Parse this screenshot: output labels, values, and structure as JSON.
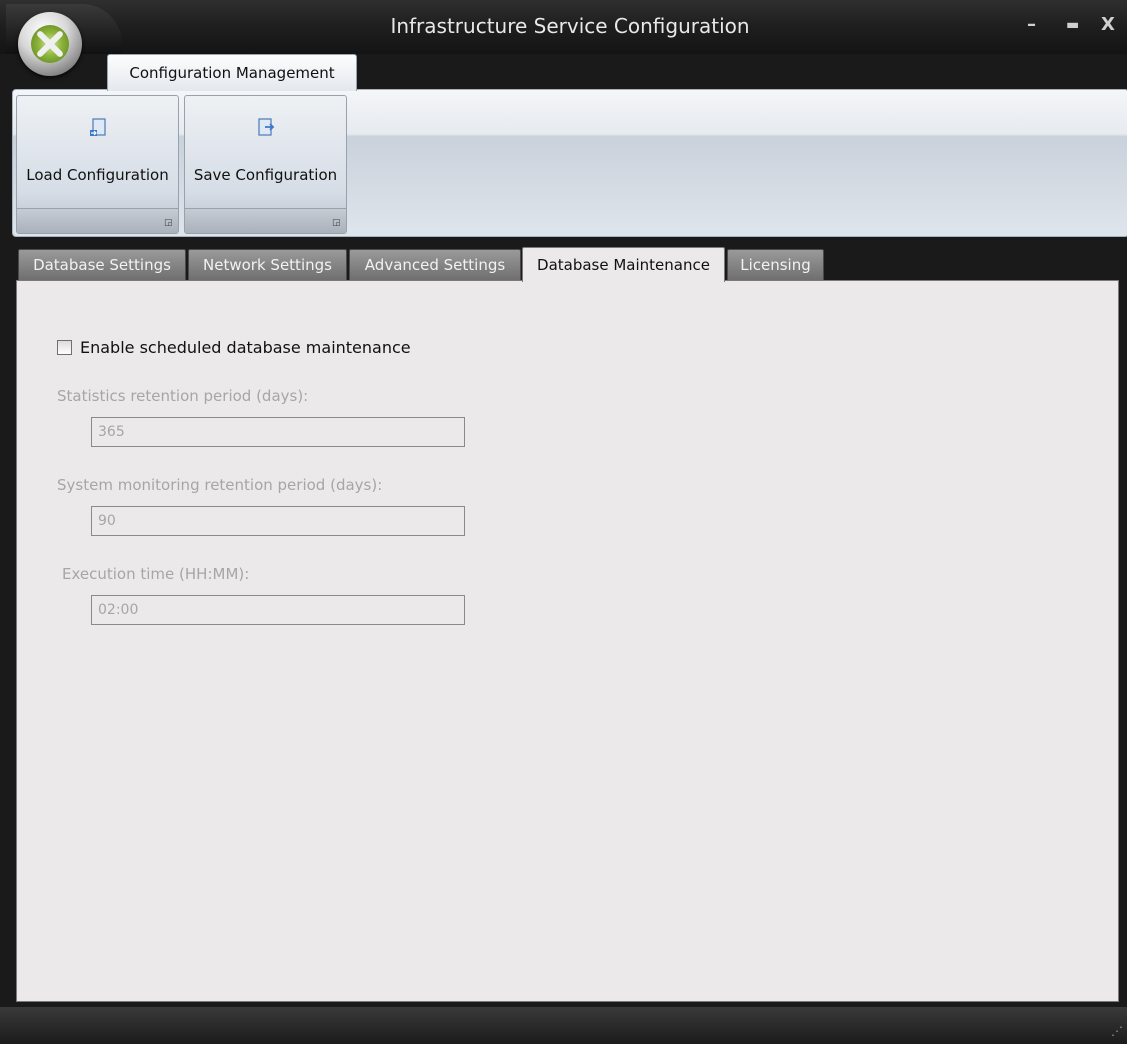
{
  "window": {
    "title": "Infrastructure Service Configuration",
    "minimize": "–",
    "maximize": "▬",
    "close": "X"
  },
  "ribbon": {
    "tab_label": "Configuration Management",
    "buttons": [
      {
        "label": "Load Configuration",
        "icon": "load-config-icon"
      },
      {
        "label": "Save Configuration",
        "icon": "save-config-icon"
      }
    ]
  },
  "tabs": [
    {
      "label": "Database Settings",
      "active": false
    },
    {
      "label": "Network Settings",
      "active": false
    },
    {
      "label": "Advanced Settings",
      "active": false
    },
    {
      "label": "Database Maintenance",
      "active": true
    },
    {
      "label": "Licensing",
      "active": false
    }
  ],
  "maintenance": {
    "enable_label": "Enable scheduled database maintenance",
    "enabled": false,
    "statistics_label": "Statistics retention period (days):",
    "statistics_value": "365",
    "monitoring_label": "System monitoring retention period (days):",
    "monitoring_value": "90",
    "execution_label": "Execution time (HH:MM):",
    "execution_value": "02:00"
  },
  "colors": {
    "frame": "#1a1a1a",
    "content_bg": "#ece9ea",
    "disabled_text": "#a6a6a6"
  }
}
